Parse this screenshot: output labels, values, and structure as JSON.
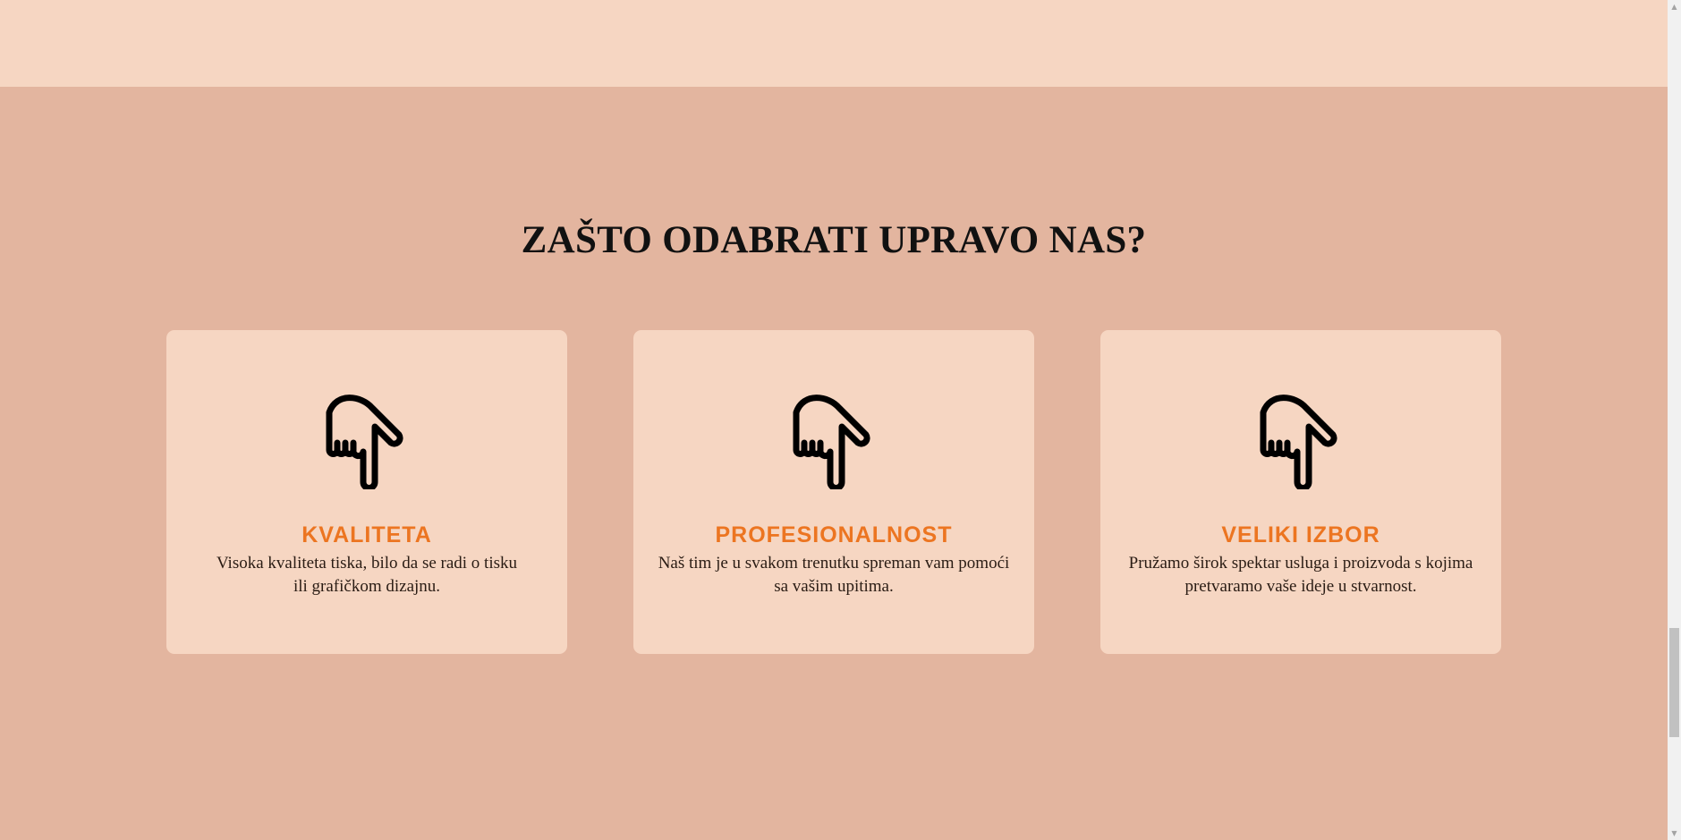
{
  "section": {
    "title": "ZAŠTO ODABRATI UPRAVO NAS?"
  },
  "cards": [
    {
      "icon": "hand-pointing-down-icon",
      "title": "KVALITETA",
      "text_line1": "Visoka kvaliteta tiska, bilo da se radi o tisku",
      "text_line2": "ili grafičkom dizajnu."
    },
    {
      "icon": "hand-pointing-down-icon",
      "title": "PROFESIONALNOST",
      "text_line1": "Naš tim je u svakom trenutku spreman vam pomoći",
      "text_line2": "sa vašim upitima."
    },
    {
      "icon": "hand-pointing-down-icon",
      "title": "VELIKI IZBOR",
      "text_line1": "Pružamo širok spektar usluga i proizvoda s kojima",
      "text_line2": "pretvaramo vaše ideje u stvarnost."
    }
  ],
  "colors": {
    "page_background": "#e3b59f",
    "card_background": "#f6d6c2",
    "accent": "#ec7521",
    "text": "#111111"
  },
  "scrollbar": {
    "up_arrow": "▲",
    "down_arrow": "▼"
  }
}
